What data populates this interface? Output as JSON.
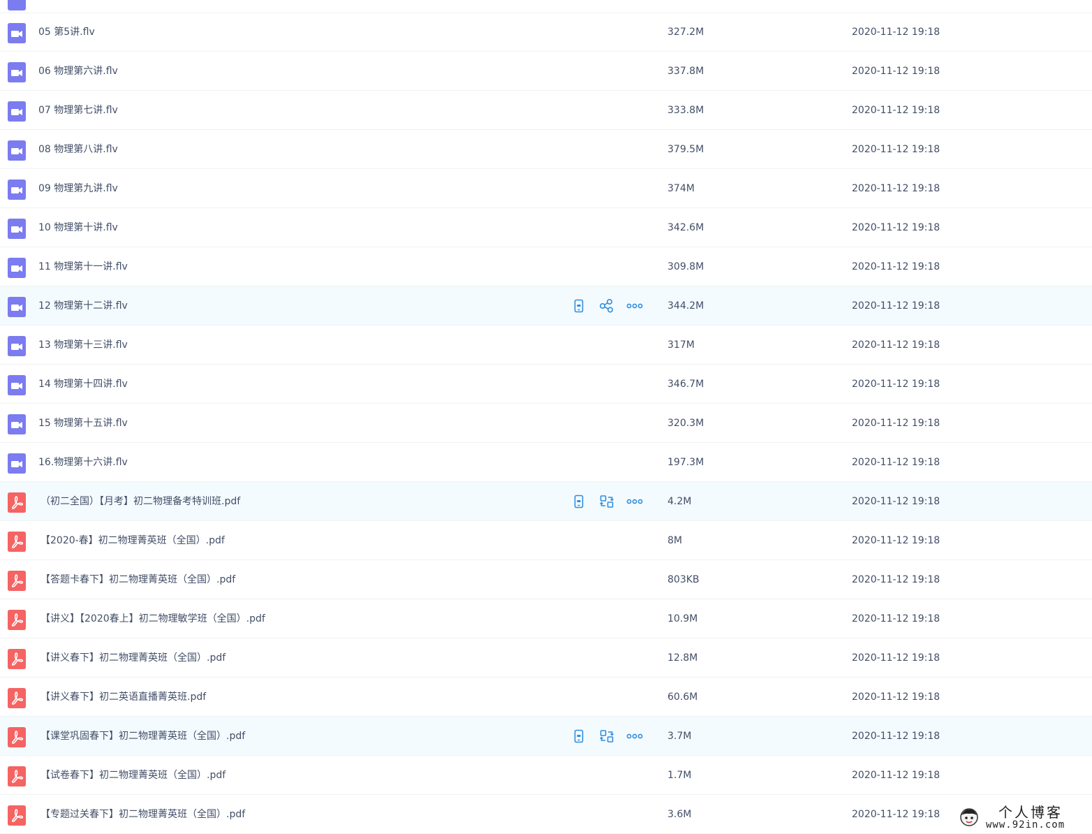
{
  "colors": {
    "video_icon": "#7b7cf0",
    "pdf_icon": "#f56363",
    "action_icon": "#2f8ddf",
    "row_highlight": "#f4fbff",
    "text": "#424e67"
  },
  "files": [
    {
      "type": "video",
      "icon": "video-file-icon",
      "name": "05 第5讲.flv",
      "size": "327.2M",
      "date": "2020-11-12 19:18",
      "highlighted": false
    },
    {
      "type": "video",
      "icon": "video-file-icon",
      "name": "06 物理第六讲.flv",
      "size": "337.8M",
      "date": "2020-11-12 19:18",
      "highlighted": false
    },
    {
      "type": "video",
      "icon": "video-file-icon",
      "name": "07 物理第七讲.flv",
      "size": "333.8M",
      "date": "2020-11-12 19:18",
      "highlighted": false
    },
    {
      "type": "video",
      "icon": "video-file-icon",
      "name": "08 物理第八讲.flv",
      "size": "379.5M",
      "date": "2020-11-12 19:18",
      "highlighted": false
    },
    {
      "type": "video",
      "icon": "video-file-icon",
      "name": "09 物理第九讲.flv",
      "size": "374M",
      "date": "2020-11-12 19:18",
      "highlighted": false
    },
    {
      "type": "video",
      "icon": "video-file-icon",
      "name": "10 物理第十讲.flv",
      "size": "342.6M",
      "date": "2020-11-12 19:18",
      "highlighted": false
    },
    {
      "type": "video",
      "icon": "video-file-icon",
      "name": "11 物理第十一讲.flv",
      "size": "309.8M",
      "date": "2020-11-12 19:18",
      "highlighted": false
    },
    {
      "type": "video",
      "icon": "video-file-icon",
      "name": "12 物理第十二讲.flv",
      "size": "344.2M",
      "date": "2020-11-12 19:18",
      "highlighted": true,
      "actions": [
        "phone-icon",
        "share-icon",
        "more-icon"
      ]
    },
    {
      "type": "video",
      "icon": "video-file-icon",
      "name": "13 物理第十三讲.flv",
      "size": "317M",
      "date": "2020-11-12 19:18",
      "highlighted": false
    },
    {
      "type": "video",
      "icon": "video-file-icon",
      "name": "14 物理第十四讲.flv",
      "size": "346.7M",
      "date": "2020-11-12 19:18",
      "highlighted": false
    },
    {
      "type": "video",
      "icon": "video-file-icon",
      "name": "15 物理第十五讲.flv",
      "size": "320.3M",
      "date": "2020-11-12 19:18",
      "highlighted": false
    },
    {
      "type": "video",
      "icon": "video-file-icon",
      "name": "16.物理第十六讲.flv",
      "size": "197.3M",
      "date": "2020-11-12 19:18",
      "highlighted": false
    },
    {
      "type": "pdf",
      "icon": "pdf-file-icon",
      "name": "（初二全国）【月考】初二物理备考特训班.pdf",
      "size": "4.2M",
      "date": "2020-11-12 19:18",
      "highlighted": true,
      "actions": [
        "phone-icon",
        "convert-icon",
        "more-icon"
      ]
    },
    {
      "type": "pdf",
      "icon": "pdf-file-icon",
      "name": "【2020-春】初二物理菁英班（全国）.pdf",
      "size": "8M",
      "date": "2020-11-12 19:18",
      "highlighted": false
    },
    {
      "type": "pdf",
      "icon": "pdf-file-icon",
      "name": "【答题卡春下】初二物理菁英班（全国）.pdf",
      "size": "803KB",
      "date": "2020-11-12 19:18",
      "highlighted": false
    },
    {
      "type": "pdf",
      "icon": "pdf-file-icon",
      "name": "【讲义】【2020春上】初二物理敏学班（全国）.pdf",
      "size": "10.9M",
      "date": "2020-11-12 19:18",
      "highlighted": false
    },
    {
      "type": "pdf",
      "icon": "pdf-file-icon",
      "name": "【讲义春下】初二物理菁英班（全国）.pdf",
      "size": "12.8M",
      "date": "2020-11-12 19:18",
      "highlighted": false
    },
    {
      "type": "pdf",
      "icon": "pdf-file-icon",
      "name": "【讲义春下】初二英语直播菁英班.pdf",
      "size": "60.6M",
      "date": "2020-11-12 19:18",
      "highlighted": false
    },
    {
      "type": "pdf",
      "icon": "pdf-file-icon",
      "name": "【课堂巩固春下】初二物理菁英班（全国）.pdf",
      "size": "3.7M",
      "date": "2020-11-12 19:18",
      "highlighted": true,
      "actions": [
        "phone-icon",
        "convert-icon",
        "more-icon"
      ]
    },
    {
      "type": "pdf",
      "icon": "pdf-file-icon",
      "name": "【试卷春下】初二物理菁英班（全国）.pdf",
      "size": "1.7M",
      "date": "2020-11-12 19:18",
      "highlighted": false
    },
    {
      "type": "pdf",
      "icon": "pdf-file-icon",
      "name": "【专题过关春下】初二物理菁英班（全国）.pdf",
      "size": "3.6M",
      "date": "2020-11-12 19:18",
      "highlighted": false
    }
  ],
  "watermark": {
    "title": "个人博客",
    "url": "www.92in.com"
  }
}
